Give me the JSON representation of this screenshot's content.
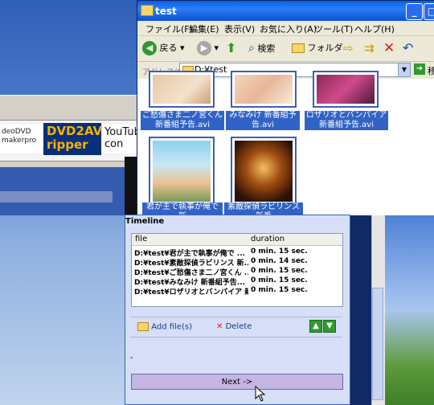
{
  "explorer": {
    "title": "test",
    "menu": [
      "ファイル(F)",
      "編集(E)",
      "表示(V)",
      "お気に入り(A)",
      "ツール(T)",
      "ヘルプ(H)"
    ],
    "toolbar": {
      "back": "戻る",
      "search": "検索",
      "folders": "フォルダ"
    },
    "address_label": "アドレス(D)",
    "address_value": "D:¥test",
    "go_label": "移",
    "files": [
      {
        "name": "ご愁傷さま二ノ宮くん 新番組予告.avi"
      },
      {
        "name": "みなみけ 新番組予告.avi"
      },
      {
        "name": "ロザリオとバンパイア 新番組予告.avi"
      },
      {
        "name": "君が主で執事が俺で 新"
      },
      {
        "name": "素敵探偵ラビリンス 新番"
      }
    ]
  },
  "background_app": {
    "logo1": "deoDVD makerpro",
    "logo2": "DVD2AV ripper",
    "logo3": "YouTub con"
  },
  "timeline": {
    "title": "Timeline",
    "columns": [
      "file",
      "duration"
    ],
    "rows": [
      {
        "file": "D:¥test¥君が主で執事が俺で ...",
        "duration": "0 min. 15 sec."
      },
      {
        "file": "D:¥test¥素敵探偵ラビリンス 新...",
        "duration": "0 min. 14 sec."
      },
      {
        "file": "D:¥test¥ご愁傷さま二ノ宮くん ...",
        "duration": "0 min. 15 sec."
      },
      {
        "file": "D:¥test¥みなみけ 新番組予告...",
        "duration": "0 min. 15 sec."
      },
      {
        "file": "D:¥test¥ロザリオとバンパイア 新...",
        "duration": "0 min. 15 sec."
      }
    ],
    "add_files": "Add file(s)",
    "delete": "Delete",
    "dash": "-",
    "next": "Next ->"
  }
}
